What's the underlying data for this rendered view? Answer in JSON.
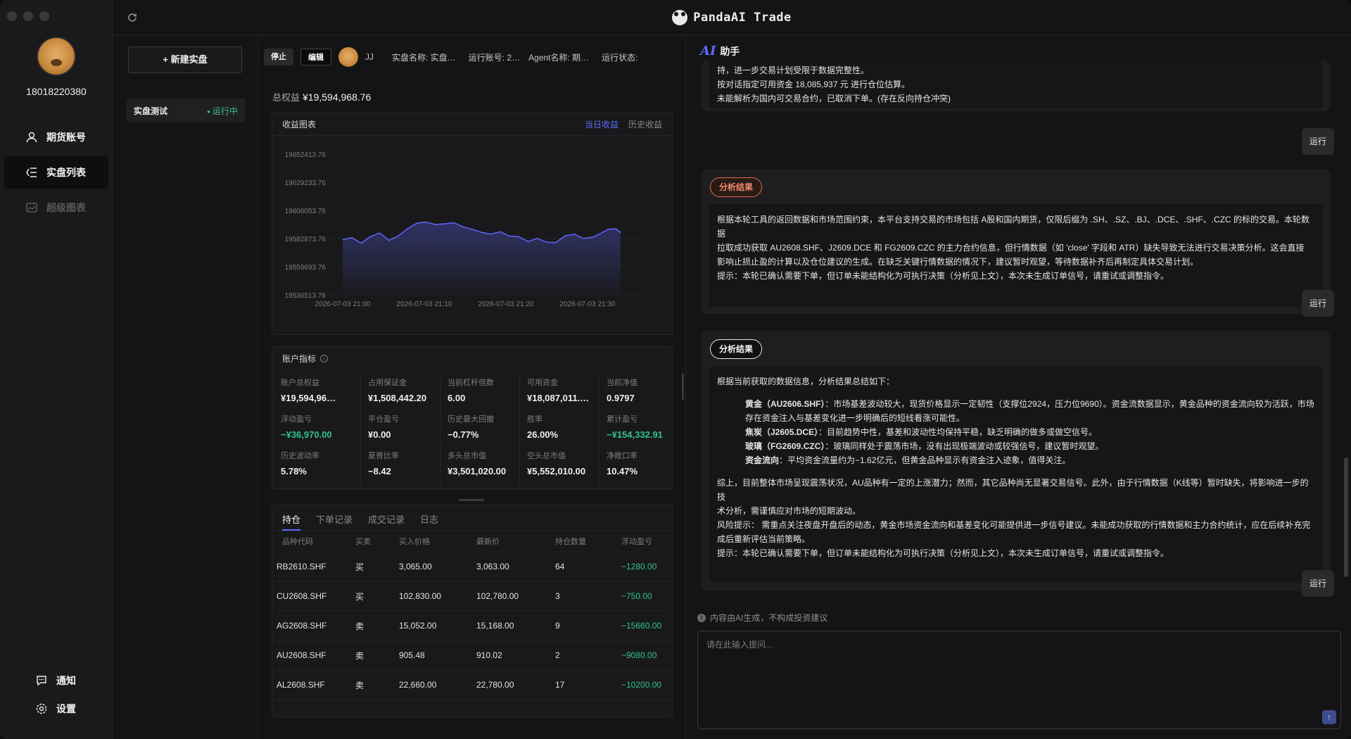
{
  "app": {
    "title": "PandaAI Trade"
  },
  "user": {
    "phone": "18018220380"
  },
  "nav": {
    "items": [
      {
        "label": "期货账号",
        "icon": "user-icon"
      },
      {
        "label": "实盘列表",
        "icon": "list-icon"
      },
      {
        "label": "超级图表",
        "icon": "chart-icon"
      }
    ],
    "notify": "通知",
    "settings": "设置"
  },
  "list": {
    "new_button": "+ 新建实盘",
    "items": [
      {
        "name": "实盘测试",
        "status": "运行中"
      }
    ]
  },
  "toolbar": {
    "stop": "停止",
    "edit": "编辑",
    "user": "JJ",
    "fields": [
      "实盘名称:  实盘…",
      "运行账号:  2…",
      "Agent名称:  期…",
      "运行状态:"
    ]
  },
  "equity": {
    "label": "总权益",
    "value": "¥19,594,968.76"
  },
  "chart_panel": {
    "title": "收益图表",
    "tab_today": "当日收益",
    "tab_history": "历史收益"
  },
  "chart_data": {
    "type": "area",
    "title": "",
    "x_ticks": [
      "2026-07-03 21:00",
      "2026-07-03 21:10",
      "2026-07-03 21:20",
      "2026-07-03 21:30"
    ],
    "y_ticks": [
      "19652413.76",
      "19629233.76",
      "19606053.76",
      "19582873.76",
      "19559693.76",
      "19536513.76"
    ],
    "ylim": [
      19536513.76,
      19652413.76
    ],
    "x": [
      0,
      1.2,
      2.4,
      3.6,
      4.8,
      6,
      7.2,
      8.4,
      9.6,
      10.8,
      12,
      13.2,
      14.4,
      15.6,
      16.8,
      18,
      19.2,
      20.4,
      21.6,
      22.8,
      24,
      25.2,
      26.4,
      27.6,
      28.8,
      30,
      31.2,
      32.4,
      33.4,
      34.4,
      35.4,
      36
    ],
    "values": [
      19582000,
      19583500,
      19579000,
      19584500,
      19587500,
      19581500,
      19585000,
      19591000,
      19595500,
      19596500,
      19594500,
      19595000,
      19596000,
      19592500,
      19590500,
      19588000,
      19586500,
      19588500,
      19585000,
      19584500,
      19580500,
      19583000,
      19580000,
      19579500,
      19585000,
      19586500,
      19583000,
      19584000,
      19587000,
      19590500,
      19591000,
      19588000
    ],
    "grid": true,
    "color": "#5b62f0"
  },
  "metrics": {
    "title": "账户指标",
    "items": [
      {
        "label": "账户总权益",
        "value": "¥19,594,96…",
        "neg": false
      },
      {
        "label": "占用保证金",
        "value": "¥1,508,442.20",
        "neg": false
      },
      {
        "label": "当前杠杆倍数",
        "value": "6.00",
        "neg": false
      },
      {
        "label": "可用资金",
        "value": "¥18,087,011.…",
        "neg": false
      },
      {
        "label": "当前净值",
        "value": "0.9797",
        "neg": false
      },
      {
        "label": "浮动盈亏",
        "value": "−¥36,970.00",
        "neg": true
      },
      {
        "label": "平仓盈亏",
        "value": "¥0.00",
        "neg": false
      },
      {
        "label": "历史最大回撤",
        "value": "−0.77%",
        "neg": false
      },
      {
        "label": "胜率",
        "value": "26.00%",
        "neg": false
      },
      {
        "label": "累计盈亏",
        "value": "−¥154,332.91",
        "neg": true
      },
      {
        "label": "历史波动率",
        "value": "5.78%",
        "neg": false
      },
      {
        "label": "夏普比率",
        "value": "−8.42",
        "neg": false
      },
      {
        "label": "多头总市值",
        "value": "¥3,501,020.00",
        "neg": false
      },
      {
        "label": "空头总市值",
        "value": "¥5,552,010.00",
        "neg": false
      },
      {
        "label": "净敞口率",
        "value": "10.47%",
        "neg": false
      }
    ]
  },
  "positions": {
    "tabs": [
      "持仓",
      "下单记录",
      "成交记录",
      "日志"
    ],
    "headers": [
      "品种代码",
      "买卖",
      "买入价格",
      "最新价",
      "持仓数量",
      "浮动盈亏"
    ],
    "rows": [
      [
        "RB2610.SHF",
        "买",
        "3,065.00",
        "3,063.00",
        "64",
        "−1280.00"
      ],
      [
        "CU2608.SHF",
        "买",
        "102,830.00",
        "102,780.00",
        "3",
        "−750.00"
      ],
      [
        "AG2608.SHF",
        "卖",
        "15,052.00",
        "15,168.00",
        "9",
        "−15660.00"
      ],
      [
        "AU2608.SHF",
        "卖",
        "905.48",
        "910.02",
        "2",
        "−9080.00"
      ],
      [
        "AL2608.SHF",
        "卖",
        "22,660.00",
        "22,780.00",
        "17",
        "−10200.00"
      ]
    ]
  },
  "ai": {
    "title": "助手",
    "logo": "AI",
    "card1_lines": [
      "持，进一步交易计划受限于数据完整性。",
      "按对话指定可用资金 18,085,937 元 进行仓位估算。",
      "未能解析为国内可交易合约，已取消下单。(存在反向持仓冲突)"
    ],
    "run": "运行",
    "badge": "分析结果",
    "card2_lines": [
      "根据本轮工具的返回数据和市场范围约束，本平台支持交易的市场包括 A股和国内期货，仅限后缀为 .SH、.SZ、.BJ、.DCE、.SHF、.CZC 的标的交易。本轮数据",
      "拉取成功获取 AU2608.SHF、J2609.DCE 和 FG2609.CZC 的主力合约信息，但行情数据（如 'close' 字段和 ATR）缺失导致无法进行交易决策分析。这会直接",
      "影响止损止盈的计算以及仓位建议的生成。在缺乏关键行情数据的情况下，建议暂时观望，等待数据补齐后再制定具体交易计划。",
      "提示：本轮已确认需要下单，但订单未能结构化为可执行决策（分析见上文），本次未生成订单信号，请重试或调整指令。"
    ],
    "card3_intro": "根据当前获取的数据信息，分析结果总结如下：",
    "card3_bullets": [
      {
        "k": "黄金（AU2606.SHF）",
        "v": "：市场基差波动较大，现货价格显示一定韧性（支撑位2924，压力位9690）。资金流数据显示，黄金品种的资金流向较为活跃，市场"
      },
      {
        "k": "",
        "v": "存在资金注入与基差变化进一步明确后的短线看涨可能性。"
      },
      {
        "k": "焦炭（J2605.DCE）",
        "v": "：目前趋势中性，基差和波动性均保持平稳，缺乏明确的做多或做空信号。"
      },
      {
        "k": "玻璃（FG2609.CZC）",
        "v": "：玻璃同样处于震荡市场，没有出现极端波动或较强信号，建议暂时观望。"
      },
      {
        "k": "资金流向",
        "v": "：平均资金流量约为−1.62亿元，但黄金品种显示有资金注入迹象，值得关注。"
      }
    ],
    "card3_tail": [
      "综上，目前整体市场呈现震荡状况，AU品种有一定的上涨潜力；然而，其它品种尚无显著交易信号。此外，由于行情数据（K线等）暂时缺失，将影响进一步的技",
      "术分析，需谨慎应对市场的短期波动。",
      "风险提示：  需重点关注夜盘开盘后的动态，黄金市场资金流向和基差变化可能提供进一步信号建议。未能成功获取的行情数据和主力合约统计，应在后续补充完",
      "成后重新评估当前策略。",
      "提示：本轮已确认需要下单，但订单未能结构化为可执行决策（分析见上文），本次未生成订单信号，请重试或调整指令。"
    ],
    "disclaimer": "内容由AI生成，不构成投资建议",
    "placeholder": "请在此输入提问..."
  }
}
